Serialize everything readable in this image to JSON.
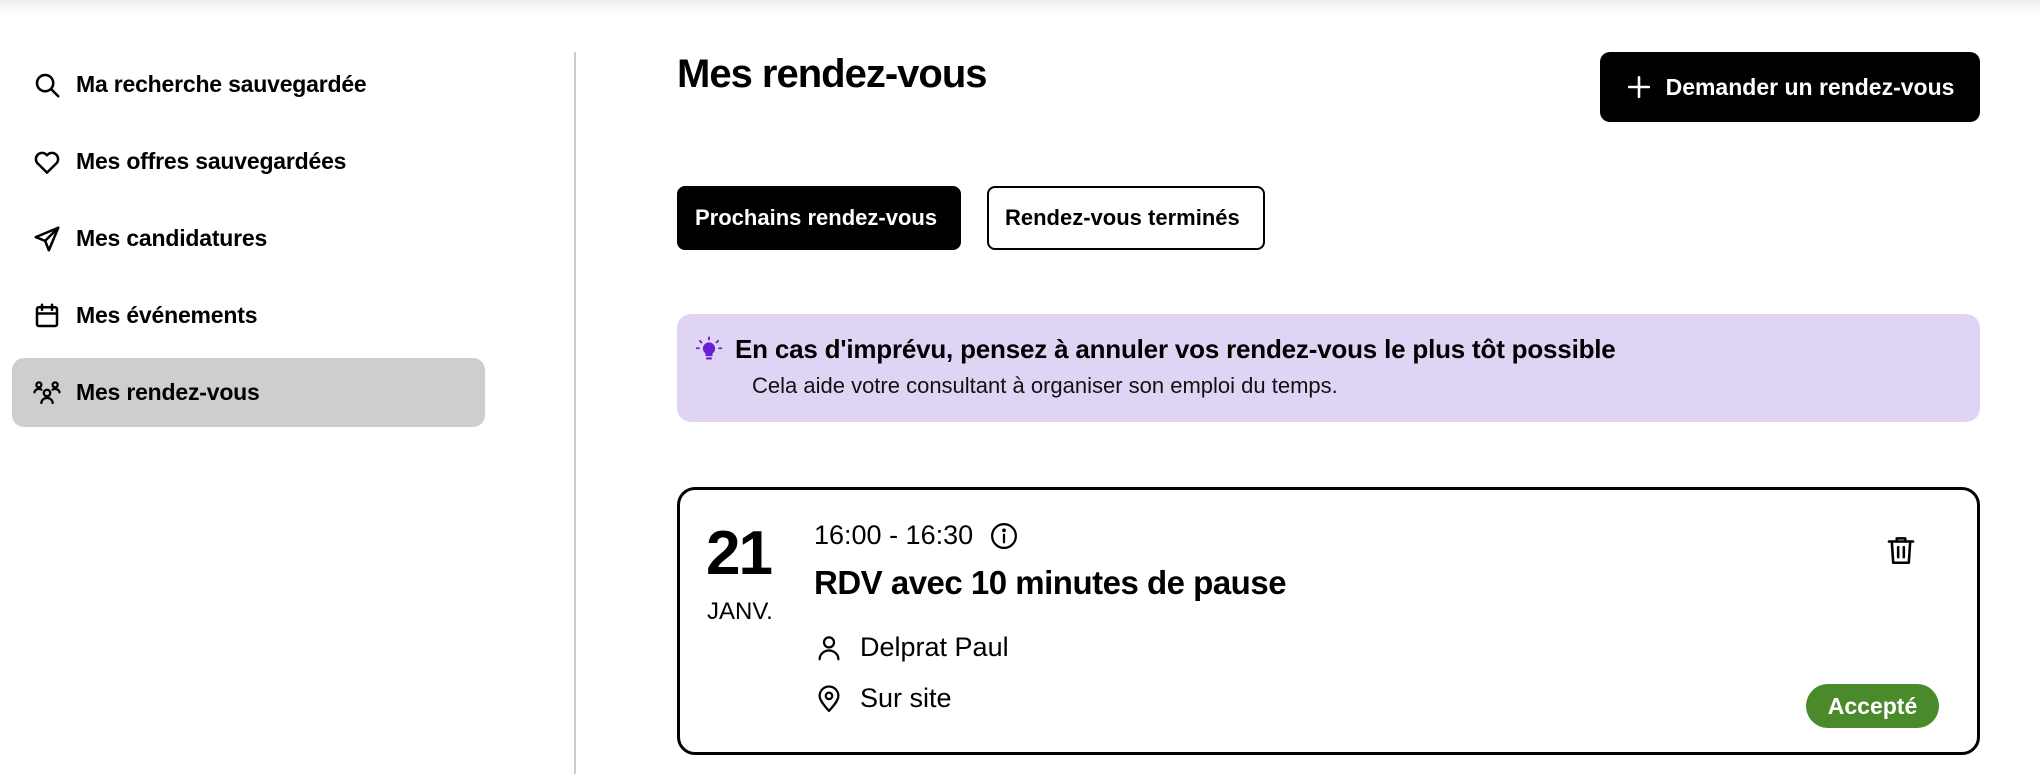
{
  "sidebar": {
    "items": [
      {
        "label": "Ma recherche sauvegardée",
        "icon": "search-icon",
        "active": false
      },
      {
        "label": "Mes offres sauvegardées",
        "icon": "heart-icon",
        "active": false
      },
      {
        "label": "Mes candidatures",
        "icon": "send-icon",
        "active": false
      },
      {
        "label": "Mes événements",
        "icon": "calendar-icon",
        "active": false
      },
      {
        "label": "Mes rendez-vous",
        "icon": "people-icon",
        "active": true
      }
    ]
  },
  "main": {
    "title": "Mes rendez-vous",
    "request_button": {
      "label": "Demander un rendez-vous",
      "icon": "plus-icon"
    },
    "tabs": [
      {
        "label": "Prochains rendez-vous",
        "active": true
      },
      {
        "label": "Rendez-vous terminés",
        "active": false
      }
    ],
    "banner": {
      "icon": "lightbulb-icon",
      "title": "En cas d'imprévu, pensez à annuler vos rendez-vous le plus tôt possible",
      "text": "Cela aide votre consultant à organiser son emploi du temps.",
      "background": "#e0d4f5",
      "icon_color": "#6a1fd0"
    },
    "appointment": {
      "day": "21",
      "month": "JANV.",
      "time": "16:00 - 16:30",
      "title": "RDV avec 10 minutes de pause",
      "person": "Delprat Paul",
      "location": "Sur site",
      "status": "Accepté",
      "status_color": "#4a8a2a"
    }
  }
}
